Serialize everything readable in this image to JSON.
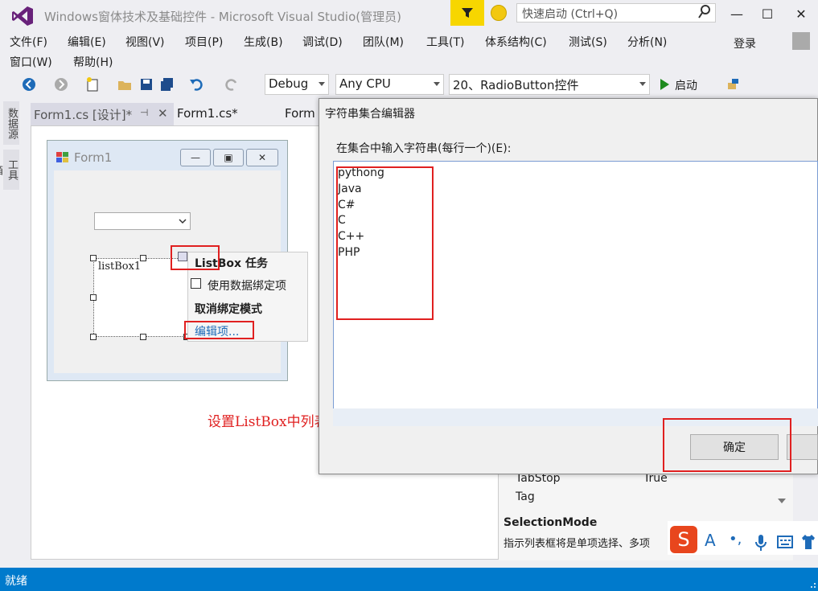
{
  "window": {
    "title": "Windows窗体技术及基础控件 - Microsoft Visual Studio(管理员)",
    "quick_launch_placeholder": "快速启动 (Ctrl+Q)",
    "login_label": "登录"
  },
  "menu": {
    "items": [
      "文件(F)",
      "编辑(E)",
      "视图(V)",
      "项目(P)",
      "生成(B)",
      "调试(D)",
      "团队(M)",
      "工具(T)",
      "体系结构(C)",
      "测试(S)",
      "分析(N)",
      "窗口(W)",
      "帮助(H)"
    ]
  },
  "toolbar": {
    "config": "Debug",
    "platform": "Any CPU",
    "startup_project": "20、RadioButton控件",
    "start_label": "启动"
  },
  "sidebar": {
    "tabs": [
      "数据源",
      "工具箱"
    ]
  },
  "tabs": [
    "Form1.cs [设计]*",
    "Form1.cs*",
    "Form"
  ],
  "designer": {
    "form_title": "Form1",
    "listbox_text": "listBox1",
    "tasks": {
      "title": "ListBox 任务",
      "use_data_bound": "使用数据绑定项",
      "unbind_mode": "取消绑定模式",
      "edit_items": "编辑项..."
    },
    "annotation": "设置ListBox中列表内容"
  },
  "properties": {
    "rows": [
      {
        "name": "TabStop",
        "value": "True"
      },
      {
        "name": "Tag",
        "value": ""
      }
    ],
    "desc_title": "SelectionMode",
    "desc_text": "指示列表框将是单项选择、多项"
  },
  "dialog": {
    "title": "字符串集合编辑器",
    "prompt": "在集合中输入字符串(每行一个)(E):",
    "content": "pythong\nJava\nC#\nC\nC++\nPHP",
    "ok_label": "确定"
  },
  "status": {
    "text": "就绪"
  },
  "colors": {
    "accent": "#007acc",
    "highlight": "#e02020",
    "filter": "#f7d600"
  }
}
